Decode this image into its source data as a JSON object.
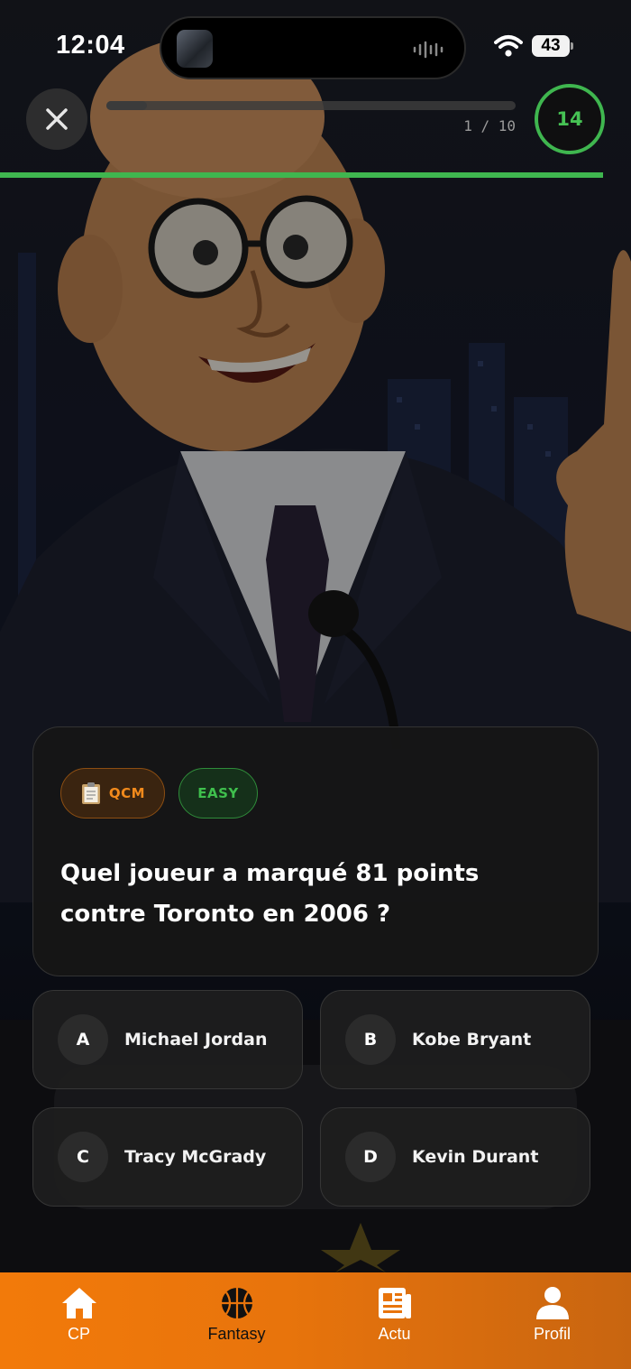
{
  "status_bar": {
    "time": "12:04",
    "battery": "43"
  },
  "quiz": {
    "progress_text": "1 / 10",
    "progress_fraction": 0.1,
    "timer": "14",
    "timer_fraction": 0.955,
    "accent_color": "#3fb64f"
  },
  "question": {
    "type_label": "QCM",
    "level_label": "EASY",
    "text": "Quel joueur a marqué 81 points contre Toronto en 2006 ?"
  },
  "answers": [
    {
      "letter": "A",
      "text": "Michael Jordan"
    },
    {
      "letter": "B",
      "text": "Kobe Bryant"
    },
    {
      "letter": "C",
      "text": "Tracy McGrady"
    },
    {
      "letter": "D",
      "text": "Kevin Durant"
    }
  ],
  "tabs": [
    {
      "label": "CP",
      "icon": "home-icon"
    },
    {
      "label": "Fantasy",
      "icon": "basketball-icon"
    },
    {
      "label": "Actu",
      "icon": "newspaper-icon"
    },
    {
      "label": "Profil",
      "icon": "person-icon"
    }
  ],
  "colors": {
    "tab_bar": "#f27a0a",
    "type_badge": "#f28a1c",
    "level_badge": "#3fbf4d"
  }
}
